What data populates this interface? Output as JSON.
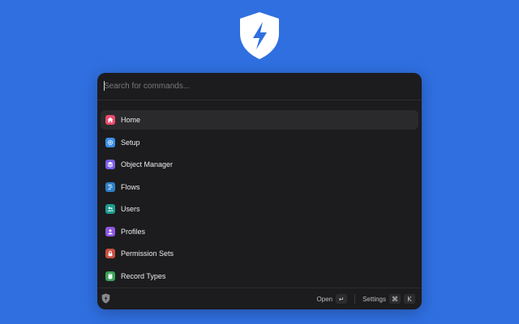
{
  "search": {
    "placeholder": "Search for commands..."
  },
  "items": [
    {
      "label": "Home",
      "icon": "home-icon",
      "color": "#e94b6d",
      "active": true
    },
    {
      "label": "Setup",
      "icon": "gear-icon",
      "color": "#3a8ee8"
    },
    {
      "label": "Object Manager",
      "icon": "layers-icon",
      "color": "#7b5ce6"
    },
    {
      "label": "Flows",
      "icon": "flow-icon",
      "color": "#2d80c9"
    },
    {
      "label": "Users",
      "icon": "users-icon",
      "color": "#1e9c8f"
    },
    {
      "label": "Profiles",
      "icon": "profile-icon",
      "color": "#8f55e0"
    },
    {
      "label": "Permission Sets",
      "icon": "lock-icon",
      "color": "#c9503f"
    },
    {
      "label": "Record Types",
      "icon": "clipboard-icon",
      "color": "#3aa35a"
    }
  ],
  "footer": {
    "open_label": "Open",
    "open_key": "↵",
    "settings_label": "Settings",
    "settings_key_mod": "⌘",
    "settings_key": "K"
  },
  "colors": {
    "background": "#2f6fe0",
    "panel": "#1c1c1e"
  }
}
